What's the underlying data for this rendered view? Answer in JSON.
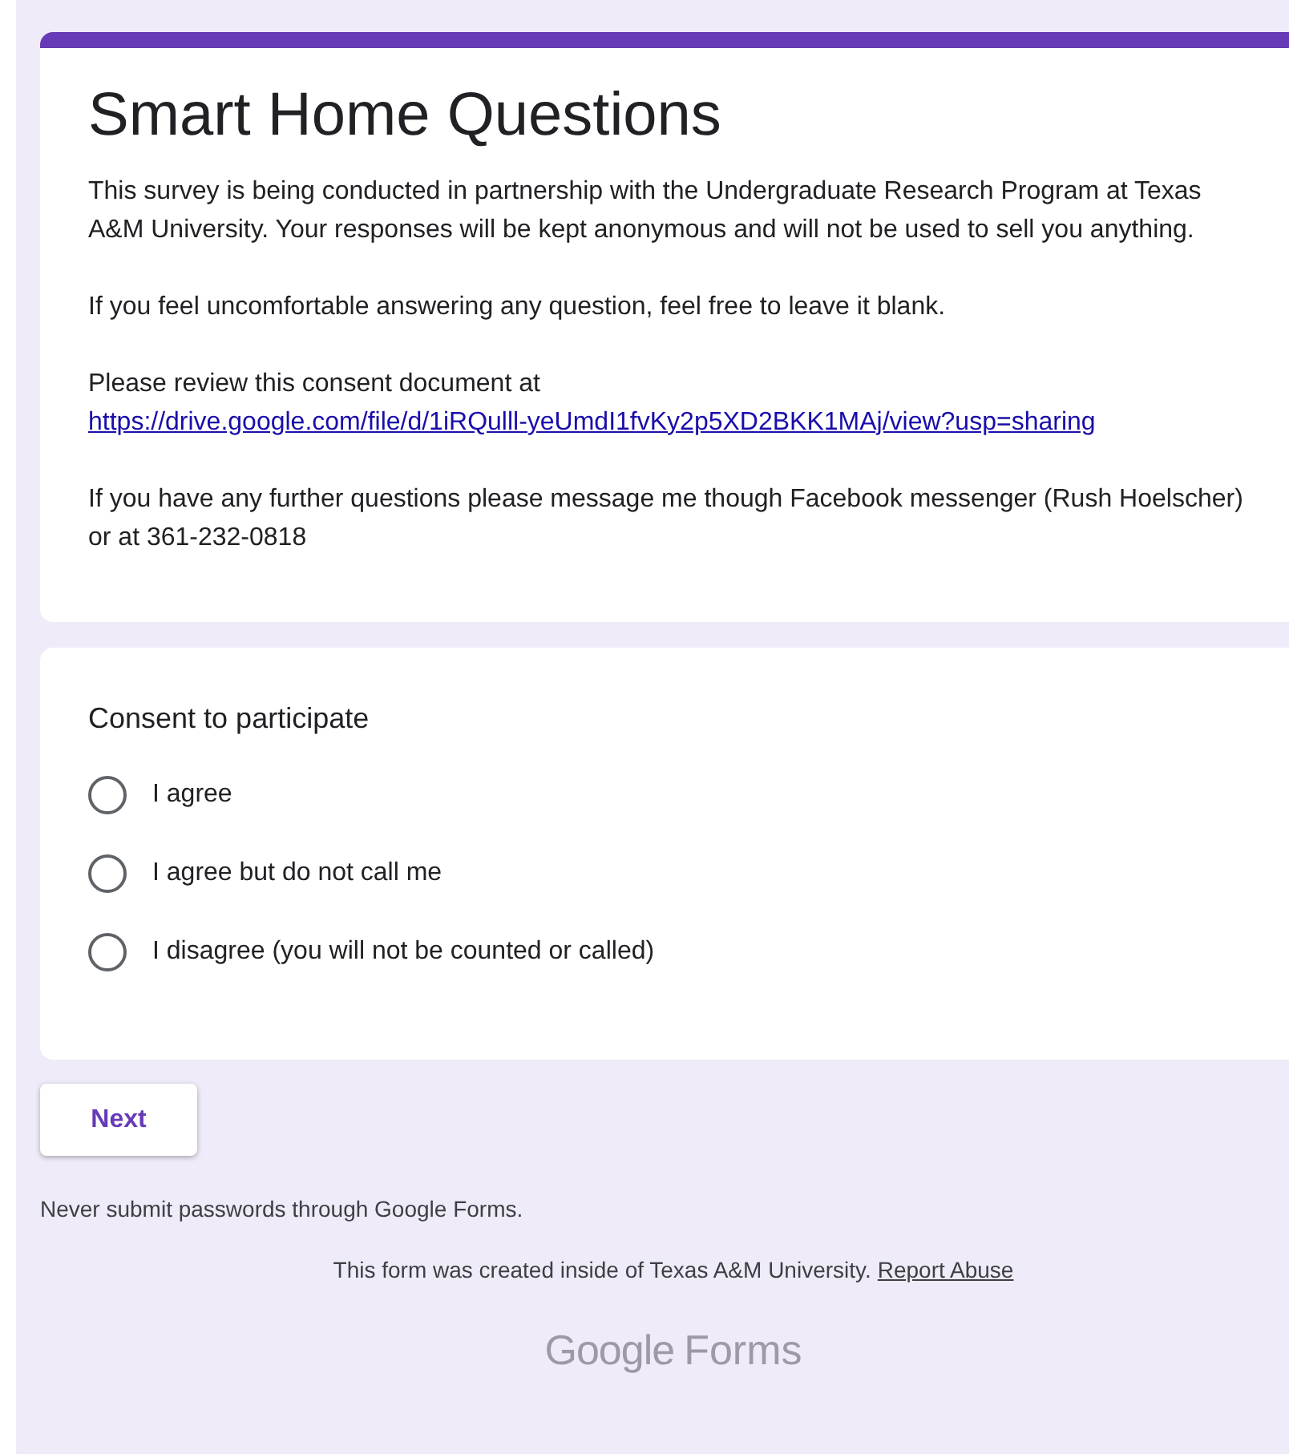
{
  "header": {
    "title": "Smart Home Questions",
    "description": [
      {
        "kind": "text",
        "text": "This survey is being conducted in partnership with the Undergraduate Research Program at Texas A&M University. Your responses will be kept anonymous and will not be used to sell you anything."
      },
      {
        "kind": "text",
        "text": "If you feel uncomfortable answering any question, feel free to leave it blank."
      },
      {
        "kind": "link",
        "text": "Please review this consent document at",
        "link": "https://drive.google.com/file/d/1iRQulll-yeUmdI1fvKy2p5XD2BKK1MAj/view?usp=sharing"
      },
      {
        "kind": "text",
        "text": "If you have any further questions please message me though Facebook messenger (Rush Hoelscher) or at 361-232-0818"
      }
    ]
  },
  "question": {
    "title": "Consent to participate",
    "options": [
      {
        "label": "I agree",
        "selected": false
      },
      {
        "label": "I agree but do not call me",
        "selected": false
      },
      {
        "label": "I disagree (you will not be counted or called)",
        "selected": false
      }
    ]
  },
  "next_button": "Next",
  "warning": "Never submit passwords through Google Forms.",
  "footer": {
    "text": "This form was created inside of Texas A&M University.",
    "link": "Report Abuse"
  },
  "logo": {
    "first": "Google",
    "second": "Forms"
  }
}
